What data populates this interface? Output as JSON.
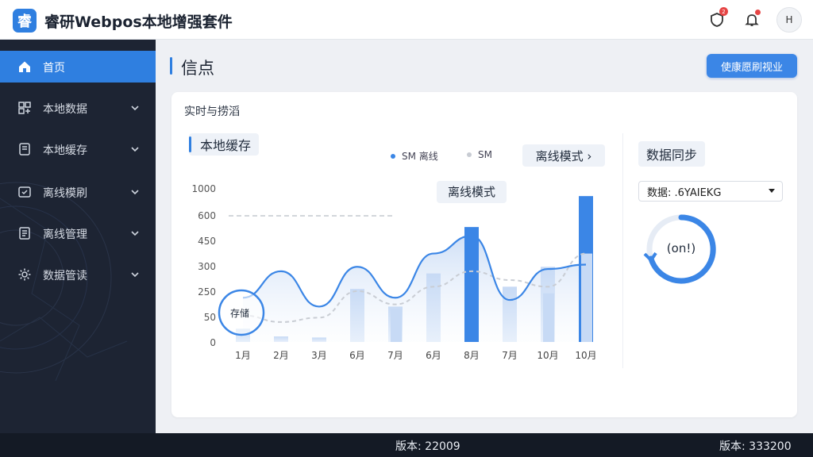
{
  "app": {
    "logo_char": "睿",
    "title": "睿研Webpos本地增强套件"
  },
  "header": {
    "notification_badge": "2"
  },
  "user": {
    "initials": "H"
  },
  "sidebar": {
    "items": [
      {
        "label": "首页",
        "icon": "home-icon",
        "active": true
      },
      {
        "label": "本地数据",
        "icon": "database-icon"
      },
      {
        "label": "本地缓存",
        "icon": "cache-icon"
      },
      {
        "label": "离线模刷",
        "icon": "offline-icon"
      },
      {
        "label": "离线管理",
        "icon": "list-icon"
      },
      {
        "label": "数据管读",
        "icon": "gear-icon"
      }
    ]
  },
  "page": {
    "title": "信点",
    "primary_button": "使康愿刷视业"
  },
  "card": {
    "title": "实时与捞滔",
    "section_label": "本地缓存",
    "legend": [
      {
        "label": "SM 离线",
        "color": "#3b86e6"
      },
      {
        "label": "SM",
        "color": "#c8ccd3"
      }
    ],
    "mode_chip": "离线模式 ›",
    "circle_label": "存储"
  },
  "sync": {
    "title": "数据同步",
    "select_value": "数据: .6YAIEKG",
    "status_label": "(on!)",
    "accent": "#3b86e6"
  },
  "chart_data": {
    "type": "bar",
    "categories": [
      "1月",
      "2月",
      "3月",
      "6月",
      "7月",
      "6月",
      "8月",
      "7月",
      "10月",
      "10月"
    ],
    "y_ticks": [
      "1000",
      "600",
      "450",
      "300",
      "250",
      "50",
      "0"
    ],
    "series": [
      {
        "values": [
          60,
          25,
          20,
          240,
          160,
          310,
          520,
          250,
          340,
          660
        ],
        "color": "#3b86e6"
      }
    ],
    "secondary_bars": [
      0,
      0,
      0,
      0,
      150,
      0,
      0,
      0,
      220,
      400
    ],
    "line": [
      200,
      320,
      160,
      340,
      200,
      400,
      480,
      190,
      330,
      350
    ],
    "dashed_line": [
      120,
      90,
      110,
      230,
      170,
      250,
      320,
      280,
      250,
      400
    ],
    "peak_label": "离线模式",
    "ylim": [
      0,
      700
    ]
  },
  "footer": {
    "version_center": "版本: 22009",
    "version_right": "版本: 333200"
  }
}
